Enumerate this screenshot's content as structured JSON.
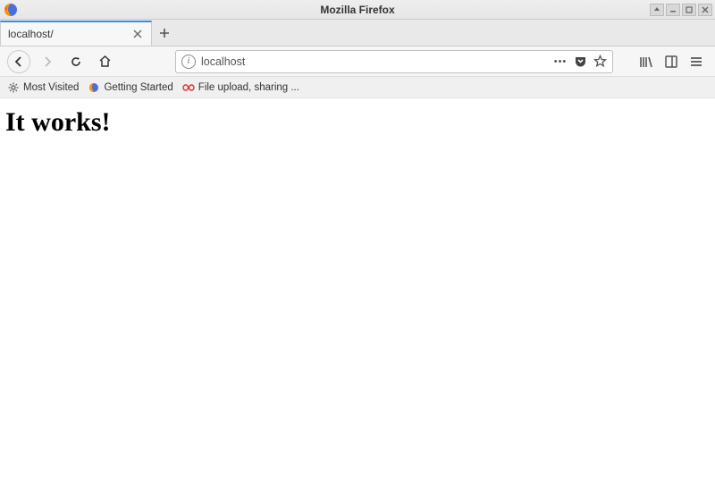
{
  "window": {
    "title": "Mozilla Firefox"
  },
  "tabs": [
    {
      "title": "localhost/",
      "active": true
    }
  ],
  "nav": {
    "back_enabled": true,
    "forward_enabled": false
  },
  "urlbar": {
    "value": "localhost",
    "more_label": "•••"
  },
  "bookmarks": [
    {
      "label": "Most Visited",
      "icon": "gear"
    },
    {
      "label": "Getting Started",
      "icon": "firefox"
    },
    {
      "label": "File upload, sharing ...",
      "icon": "link"
    }
  ],
  "page": {
    "heading": "It works!"
  }
}
